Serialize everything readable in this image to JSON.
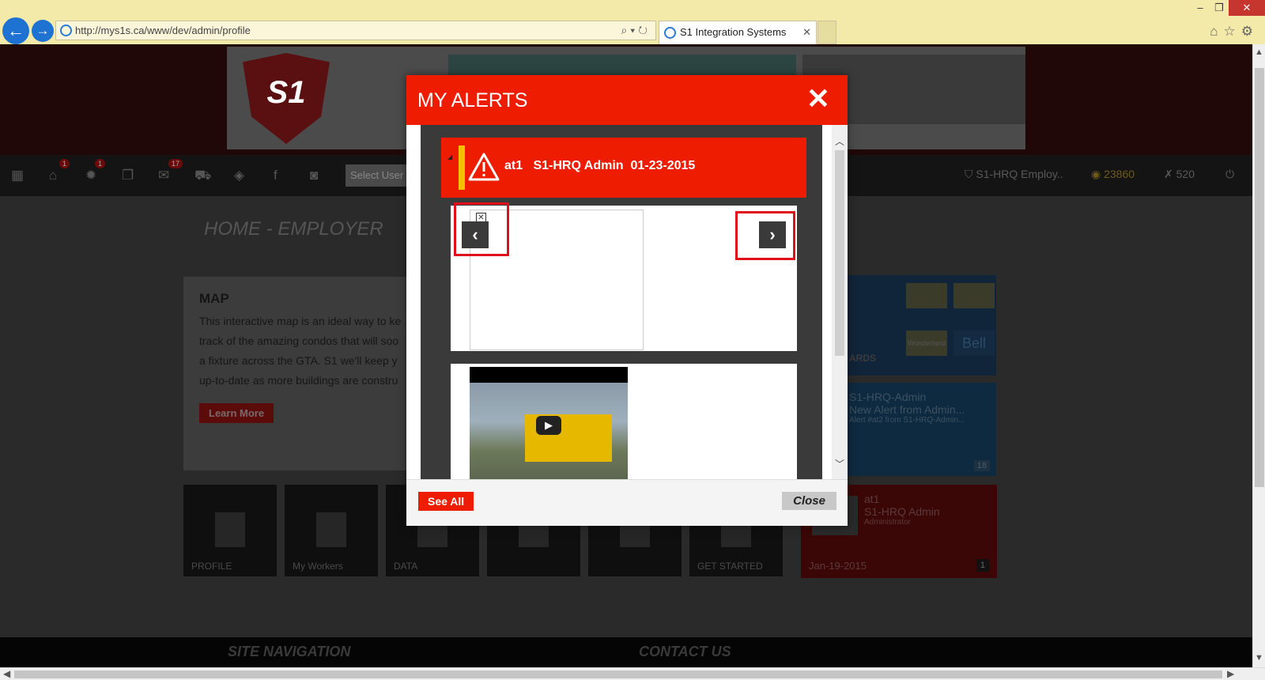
{
  "browser": {
    "url": "http://mys1s.ca/www/dev/admin/profile",
    "tab_title": "S1 Integration Systems",
    "tab_close": "✕",
    "back_label": "←",
    "forward_label": "→"
  },
  "header": {
    "logo_text": "S1",
    "select_user_placeholder": "Select User",
    "badges": {
      "home": "1",
      "settings": "1",
      "mail": "17"
    },
    "user_label": "S1-HRQ Employ..",
    "points": "23860",
    "score": "520"
  },
  "page": {
    "title": "HOME - EMPLOYER",
    "map_card": {
      "title": "MAP",
      "text": "This interactive map is an ideal way to ke track of the amazing condos that will soo a fixture across the GTA. S1 we'll keep y up-to-date as more buildings are constru",
      "button": "Learn More"
    },
    "awards_label": "ARDS",
    "awards_logos": [
      "",
      "",
      "Wonderland",
      "Bell"
    ],
    "alert_card": {
      "name": "S1-HRQ-Admin",
      "title": "New Alert from Admin...",
      "subtitle": "Alert #at2 from S1-HRQ-Admin...",
      "count": "18"
    },
    "profile_card": {
      "name": "at1",
      "company": "S1-HRQ Admin",
      "role": "Administrator",
      "date": "Jan-19-2015",
      "count": "1"
    },
    "tiles": [
      "PROFILE",
      "My Workers",
      "DATA",
      "",
      "",
      "GET STARTED"
    ],
    "footer": {
      "site_nav": "SITE NAVIGATION",
      "contact": "CONTACT US"
    }
  },
  "modal": {
    "title": "MY ALERTS",
    "close_x": "✕",
    "alert": {
      "name": "at1",
      "from": "S1-HRQ Admin",
      "date": "01-23-2015"
    },
    "prev_label": "‹",
    "next_label": "›",
    "image_close": "✕",
    "play_label": "▶",
    "see_all": "See All",
    "close": "Close"
  },
  "colors": {
    "accent": "#ee1c00",
    "highlight": "#e0101a",
    "warning_bar": "#f2c200"
  }
}
